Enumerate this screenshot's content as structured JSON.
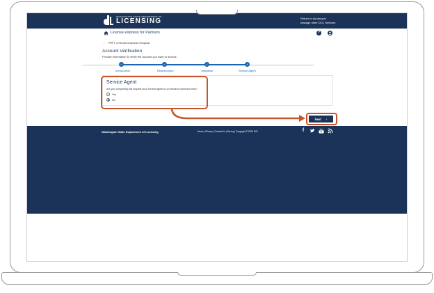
{
  "header": {
    "logo_small": "WASHINGTON STATE DEPARTMENT OF",
    "logo_big": "LICENSING",
    "link_return": "Return to dol.wa.gov",
    "link_manage": "Manage other DOL Services"
  },
  "app_bar": {
    "title": "License eXpress for Partners"
  },
  "breadcrumb": {
    "back_label": "PRFT a Services Access Request"
  },
  "page": {
    "title": "Account Verification",
    "subtitle": "Provide information to verify the account you want to access."
  },
  "stepper": {
    "steps": [
      {
        "label": "Introduction",
        "state": "complete"
      },
      {
        "label": "Request type",
        "state": "complete"
      },
      {
        "label": "Validation",
        "state": "complete"
      },
      {
        "label": "Service Agent",
        "state": "current"
      }
    ]
  },
  "service_agent": {
    "heading": "Service Agent",
    "question": "Are you completing this request as a Service Agent or on behalf of someone else?",
    "options": [
      {
        "label": "Yes",
        "checked": false
      },
      {
        "label": "No",
        "checked": true
      }
    ]
  },
  "actions": {
    "next_label": "Next"
  },
  "footer": {
    "org": "Washington State Department of Licensing",
    "links": "Home | Privacy | Contact Us | Survey | Copyright © 2023 DOL",
    "social_icons": [
      "facebook-icon",
      "twitter-icon",
      "youtube-icon",
      "rss-icon"
    ]
  },
  "colors": {
    "navy": "#1b3358",
    "step_blue": "#1b65b1",
    "highlight": "#c8542a"
  }
}
